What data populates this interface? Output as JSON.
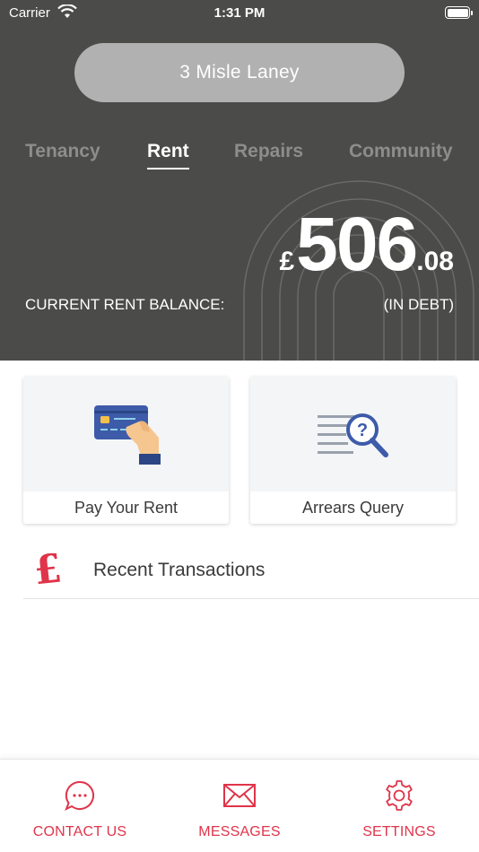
{
  "status_bar": {
    "carrier": "Carrier",
    "time": "1:31 PM"
  },
  "header": {
    "address": "3 Misle Laney",
    "tabs": [
      {
        "label": "Tenancy",
        "active": false
      },
      {
        "label": "Rent",
        "active": true
      },
      {
        "label": "Repairs",
        "active": false
      },
      {
        "label": "Community",
        "active": false
      }
    ],
    "balance": {
      "currency": "£",
      "major": "506",
      "minor": ".08",
      "label": "CURRENT RENT BALANCE:",
      "status": "(IN DEBT)"
    }
  },
  "cards": [
    {
      "label": "Pay Your Rent",
      "icon": "credit-card-hand-icon"
    },
    {
      "label": "Arrears Query",
      "icon": "document-search-icon"
    }
  ],
  "transactions": {
    "label": "Recent Transactions",
    "icon": "pound-icon"
  },
  "tabbar": {
    "items": [
      {
        "label": "CONTACT US",
        "icon": "chat-bubble-icon"
      },
      {
        "label": "MESSAGES",
        "icon": "envelope-icon"
      },
      {
        "label": "SETTINGS",
        "icon": "gear-icon"
      }
    ]
  },
  "colors": {
    "header_bg": "#4b4b49",
    "pill_bg": "#b1b1b1",
    "accent": "#e0344a",
    "card_art_bg": "#f4f5f7"
  }
}
